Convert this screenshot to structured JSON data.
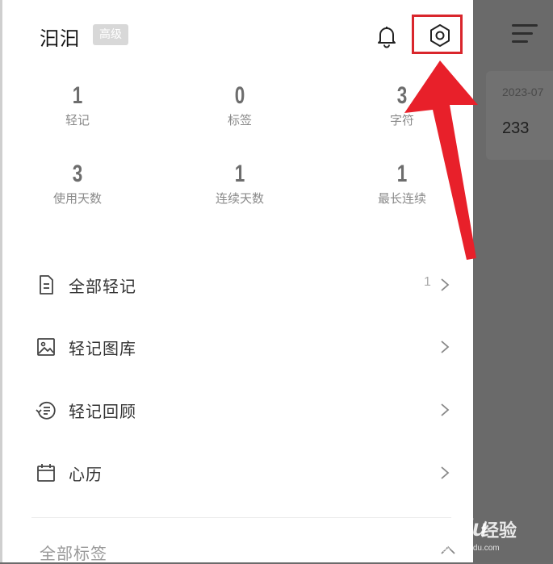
{
  "background_app": {
    "date_partial": "2023-07",
    "note_text": "233",
    "menu_icon": "hamburger-menu-icon"
  },
  "drawer": {
    "username": "汩汩",
    "badge": "高级",
    "bell_icon": "bell-icon",
    "settings_icon": "hexagon-gear-icon"
  },
  "stats": [
    {
      "value": "1",
      "label": "轻记"
    },
    {
      "value": "0",
      "label": "标签"
    },
    {
      "value": "3",
      "label": "字符"
    },
    {
      "value": "3",
      "label": "使用天数"
    },
    {
      "value": "1",
      "label": "连续天数"
    },
    {
      "value": "1",
      "label": "最长连续"
    }
  ],
  "menu": [
    {
      "label": "全部轻记",
      "count": "1",
      "icon": "document-icon"
    },
    {
      "label": "轻记图库",
      "count": "",
      "icon": "image-icon"
    },
    {
      "label": "轻记回顾",
      "count": "",
      "icon": "review-icon"
    },
    {
      "label": "心历",
      "count": "",
      "icon": "calendar-icon"
    }
  ],
  "tags_section": {
    "title": "全部标签"
  },
  "watermark": {
    "brand": "Baidu",
    "product": "经验",
    "url": "jingyan.baidu.com"
  },
  "colors": {
    "highlight": "#d9262c",
    "overlay": "#6b6b6b",
    "stat_value": "#6d6d6d"
  }
}
